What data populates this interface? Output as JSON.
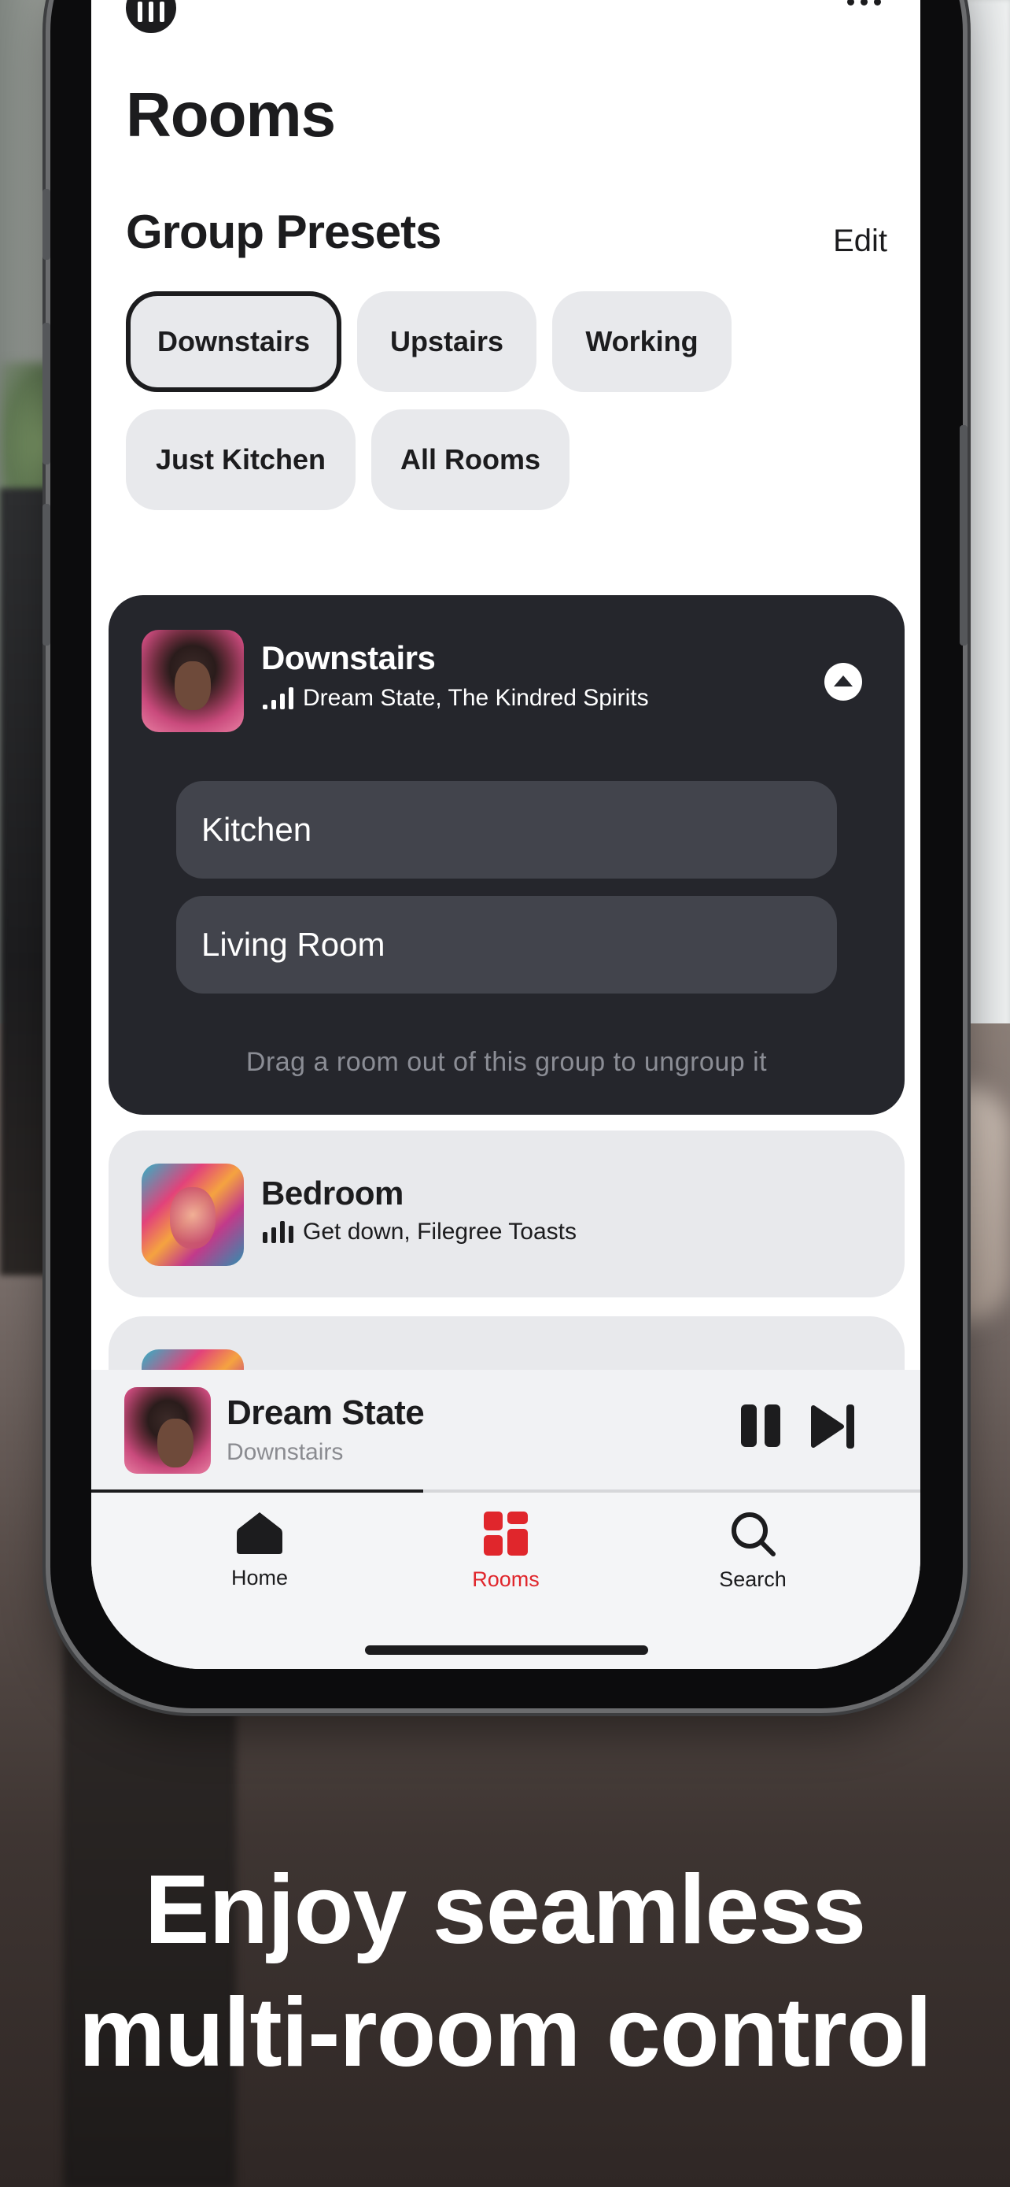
{
  "screen": {
    "title": "Rooms",
    "group_presets": {
      "heading": "Group Presets",
      "edit_label": "Edit",
      "presets": [
        "Downstairs",
        "Upstairs",
        "Working",
        "Just Kitchen",
        "All Rooms"
      ],
      "selected": "Downstairs"
    },
    "active_group": {
      "name": "Downstairs",
      "now_playing": "Dream State, The Kindred Spirits",
      "rooms": [
        "Kitchen",
        "Living Room"
      ],
      "hint": "Drag a room out of this group to ungroup it"
    },
    "rooms": [
      {
        "name": "Bedroom",
        "now_playing": "Get down, Filegree Toasts"
      }
    ],
    "mini_player": {
      "track": "Dream State",
      "room": "Downstairs",
      "progress": 0.4
    },
    "tabs": [
      {
        "label": "Home",
        "icon": "home-icon"
      },
      {
        "label": "Rooms",
        "icon": "rooms-grid-icon",
        "active": true
      },
      {
        "label": "Search",
        "icon": "search-icon"
      }
    ]
  },
  "marketing": {
    "line1": "Enjoy seamless",
    "line2": "multi-room control"
  },
  "colors": {
    "accent": "#e0262c",
    "dark_card": "#25262c",
    "chip": "#e8e9ec"
  }
}
